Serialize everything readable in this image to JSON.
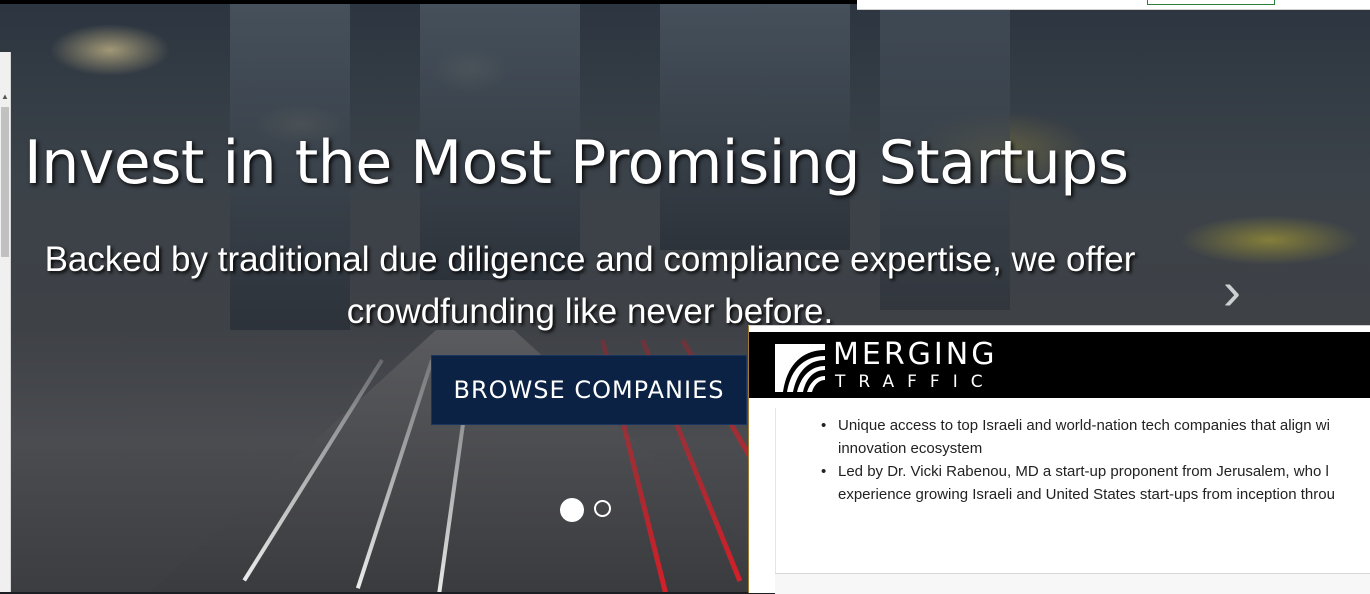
{
  "hero": {
    "headline": "Invest in the Most Promising Startups",
    "subline_1": "Backed by traditional due diligence and compliance expertise, we offer",
    "subline_2": "crowdfunding like never before.",
    "cta_label": "BROWSE COMPANIES",
    "next_arrow": "›",
    "carousel": {
      "slides": 2,
      "active": 1
    }
  },
  "popup": {
    "logo_line1": "MERGING",
    "logo_line2": "TRAFFIC",
    "bullets": [
      {
        "line1": "Unique access to top Israeli and world-nation tech companies that align wi",
        "line2": "innovation ecosystem"
      },
      {
        "line1": "Led by Dr. Vicki Rabenou, MD a start-up proponent from Jerusalem, who l",
        "line2": "experience growing Israeli and United States start-ups from inception throu"
      }
    ],
    "bullet_char": "•"
  },
  "colors": {
    "cta_bg": "#0c2244",
    "popup_header_bg": "#000000",
    "text_white": "#ffffff"
  }
}
